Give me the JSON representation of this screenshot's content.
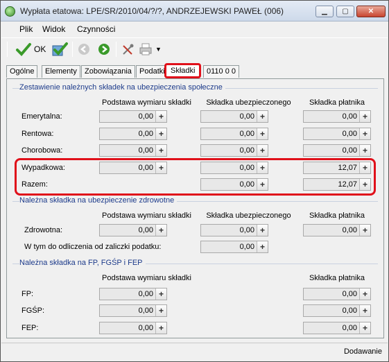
{
  "window": {
    "title": "Wypłata etatowa: LPE/SR/2010/04/?/?, ANDRZEJEWSKI PAWEŁ (006)"
  },
  "menu": [
    {
      "label": "Plik"
    },
    {
      "label": "Widok"
    },
    {
      "label": "Czynności"
    }
  ],
  "toolbar": {
    "ok_label": "OK"
  },
  "tabs": [
    {
      "label": "Ogólne"
    },
    {
      "label": "Elementy"
    },
    {
      "label": "Zobowiązania"
    },
    {
      "label": "Podatki"
    },
    {
      "label": "Składki",
      "active": true
    },
    {
      "label": "0110 0 0"
    }
  ],
  "social": {
    "title": "Zestawienie należnych składek na ubezpieczenia społeczne",
    "headers": [
      "Podstawa wymiaru składki",
      "Składka ubezpieczonego",
      "Składka płatnika"
    ],
    "rows": [
      {
        "label": "Emerytalna:",
        "values": [
          "0,00",
          "0,00",
          "0,00"
        ]
      },
      {
        "label": "Rentowa:",
        "values": [
          "0,00",
          "0,00",
          "0,00"
        ]
      },
      {
        "label": "Chorobowa:",
        "values": [
          "0,00",
          "0,00",
          "0,00"
        ]
      },
      {
        "label": "Wypadkowa:",
        "values": [
          "0,00",
          "0,00",
          "12,07"
        ]
      },
      {
        "label": "Razem:",
        "values": [
          "",
          "0,00",
          "12,07"
        ]
      }
    ]
  },
  "health": {
    "title": "Należna składka na ubezpieczenie zdrowotne",
    "headers": [
      "Podstawa wymiaru składki",
      "Składka ubezpieczonego",
      "Składka płatnika"
    ],
    "rows": [
      {
        "label": "Zdrowotna:",
        "values": [
          "0,00",
          "0,00",
          "0,00"
        ]
      },
      {
        "label": "W tym do odliczenia od zaliczki podatku:",
        "values": [
          "",
          "0,00",
          ""
        ]
      }
    ]
  },
  "funds": {
    "title": "Należna składka na FP, FGŚP i FEP",
    "headers": [
      "Podstawa wymiaru składki",
      "Składka płatnika"
    ],
    "rows": [
      {
        "label": "FP:",
        "values": [
          "0,00",
          "0,00"
        ]
      },
      {
        "label": "FGŚP:",
        "values": [
          "0,00",
          "0,00"
        ]
      },
      {
        "label": "FEP:",
        "values": [
          "0,00",
          "0,00"
        ]
      }
    ]
  },
  "status": {
    "mode": "Dodawanie"
  },
  "colors": {
    "accent_red": "#e0101a",
    "group_title": "#1c3a8a"
  }
}
